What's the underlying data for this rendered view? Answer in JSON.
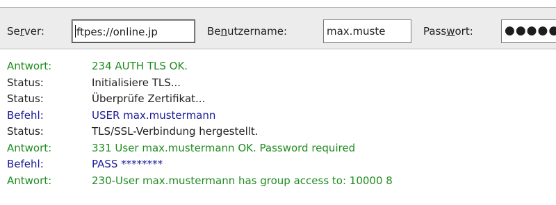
{
  "toolbar": {
    "server_label_pre": "Se",
    "server_label_u": "r",
    "server_label_post": "ver:",
    "server_value": "ftpes://online.jp",
    "username_label_pre": "Be",
    "username_label_u": "n",
    "username_label_post": "utzername:",
    "username_value": "max.muste",
    "password_label_pre": "Pass",
    "password_label_u": "w",
    "password_label_post": "ort:",
    "password_value": "●●●●●"
  },
  "colors": {
    "response": "#1f8c1f",
    "status": "#1e1e1e",
    "command": "#1c1c9a"
  },
  "log": [
    {
      "type": "Antwort:",
      "kind": "response",
      "message": "234 AUTH TLS OK."
    },
    {
      "type": "Status:",
      "kind": "status",
      "message": "Initialisiere TLS..."
    },
    {
      "type": "Status:",
      "kind": "status",
      "message": "Überprüfe Zertifikat..."
    },
    {
      "type": "Befehl:",
      "kind": "command",
      "message": "USER max.mustermann"
    },
    {
      "type": "Status:",
      "kind": "status",
      "message": "TLS/SSL-Verbindung hergestellt."
    },
    {
      "type": "Antwort:",
      "kind": "response",
      "message": "331 User max.mustermann OK. Password required"
    },
    {
      "type": "Befehl:",
      "kind": "command",
      "message": "PASS ********"
    },
    {
      "type": "Antwort:",
      "kind": "response",
      "message": "230-User max.mustermann has group access to:  10000    8"
    }
  ]
}
